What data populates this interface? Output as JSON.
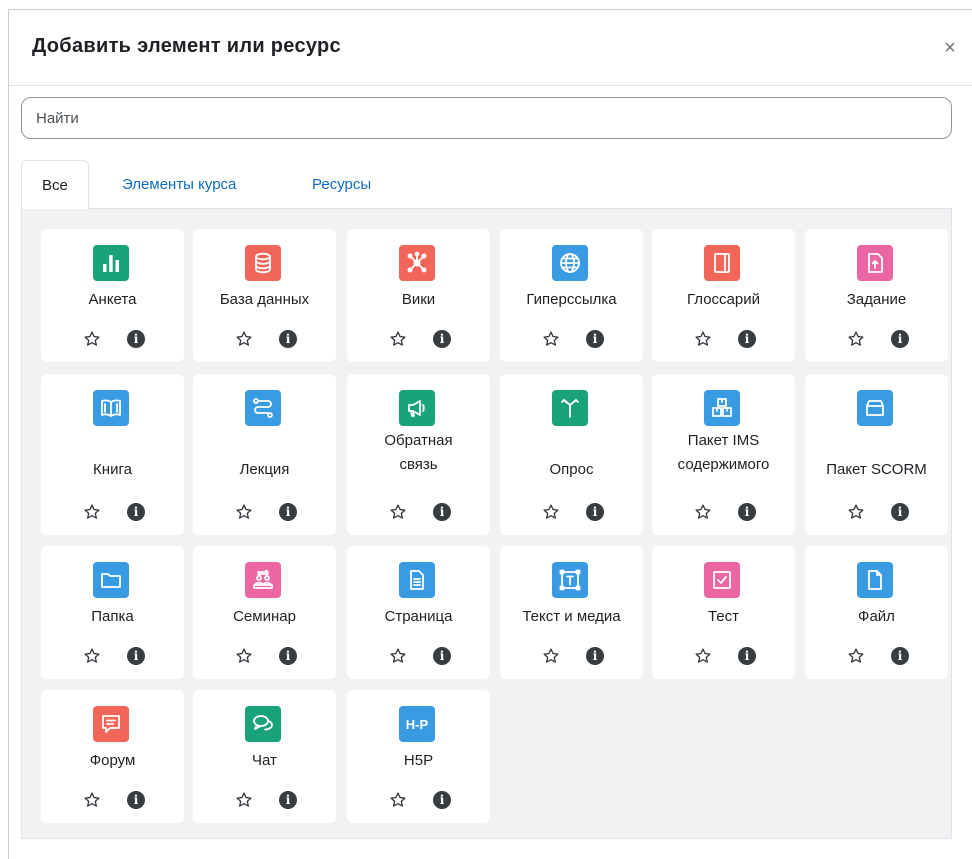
{
  "dialog": {
    "title": "Добавить элемент или ресурс",
    "close_symbol": "×"
  },
  "search": {
    "placeholder": "Найти",
    "value": ""
  },
  "tabs": [
    {
      "label": "Все",
      "active": true
    },
    {
      "label": "Элементы курса",
      "active": false
    },
    {
      "label": "Ресурсы",
      "active": false
    }
  ],
  "items": [
    {
      "label": "Анкета",
      "icon": "chart-bar-icon",
      "color": "#1aa37a"
    },
    {
      "label": "База данных",
      "icon": "database-icon",
      "color": "#f2665a"
    },
    {
      "label": "Вики",
      "icon": "network-icon",
      "color": "#f2665a"
    },
    {
      "label": "Гиперссылка",
      "icon": "globe-icon",
      "color": "#399be2"
    },
    {
      "label": "Глоссарий",
      "icon": "book-closed-icon",
      "color": "#f2665a"
    },
    {
      "label": "Задание",
      "icon": "file-upload-icon",
      "color": "#eb66a2"
    },
    {
      "label": "Книга",
      "icon": "book-open-icon",
      "color": "#399be2"
    },
    {
      "label": "Лекция",
      "icon": "route-icon",
      "color": "#399be2"
    },
    {
      "label": "Обратная связь",
      "icon": "megaphone-icon",
      "color": "#1aa37a"
    },
    {
      "label": "Опрос",
      "icon": "signpost-icon",
      "color": "#1aa37a"
    },
    {
      "label": "Пакет IMS содержимого",
      "icon": "package-icon",
      "color": "#399be2"
    },
    {
      "label": "Пакет SCORM",
      "icon": "box-icon",
      "color": "#399be2"
    },
    {
      "label": "Папка",
      "icon": "folder-icon",
      "color": "#399be2"
    },
    {
      "label": "Семинар",
      "icon": "people-exchange-icon",
      "color": "#eb66a2"
    },
    {
      "label": "Страница",
      "icon": "document-icon",
      "color": "#399be2"
    },
    {
      "label": "Текст и медиа",
      "icon": "text-frame-icon",
      "color": "#399be2"
    },
    {
      "label": "Тест",
      "icon": "checkbox-icon",
      "color": "#eb66a2"
    },
    {
      "label": "Файл",
      "icon": "file-icon",
      "color": "#399be2"
    },
    {
      "label": "Форум",
      "icon": "chat-bubble-icon",
      "color": "#f2665a"
    },
    {
      "label": "Чат",
      "icon": "chat-bubbles-icon",
      "color": "#1aa37a"
    },
    {
      "label": "H5P",
      "icon": "h5p-icon",
      "color": "#399be2",
      "icon_text": "H-P"
    }
  ]
}
